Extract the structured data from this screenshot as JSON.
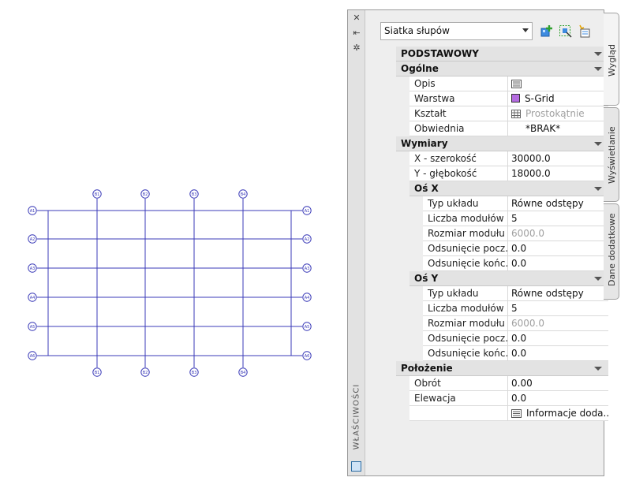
{
  "drawing": {
    "column_bubbles_top": [
      "B1",
      "B2",
      "B3",
      "B4"
    ],
    "column_bubbles_bottom": [
      "B1",
      "B2",
      "B3",
      "B4"
    ],
    "row_bubbles_left": [
      "A1",
      "A2",
      "A3",
      "A4",
      "A5",
      "A6"
    ],
    "row_bubbles_right": [
      "A1",
      "A2",
      "A3",
      "A4",
      "A5",
      "A6"
    ],
    "line_color": "#3b3bb8"
  },
  "palette": {
    "title": "WŁAŚCIWOŚCI",
    "style_select": "Siatka słupów",
    "tabs": [
      "Wygląd",
      "Wyświetlanie",
      "Dane dodatkowe"
    ],
    "icons": [
      "add-style-icon",
      "select-similar-icon",
      "quick-select-icon"
    ]
  },
  "properties": {
    "cat_basic": "PODSTAWOWY",
    "general": {
      "header": "Ogólne",
      "opis_label": "Opis",
      "warstwa_label": "Warstwa",
      "warstwa_value": "S-Grid",
      "ksztalt_label": "Kształt",
      "ksztalt_value": "Prostokątnie",
      "obwiednia_label": "Obwiednia",
      "obwiednia_value": "*BRAK*"
    },
    "dims": {
      "header": "Wymiary",
      "x_label": "X - szerokość",
      "x_value": "30000.0",
      "y_label": "Y - głębokość",
      "y_value": "18000.0"
    },
    "axis_x": {
      "header": "Oś X",
      "typ_label": "Typ układu",
      "typ_value": "Równe odstępy",
      "liczba_label": "Liczba modułów",
      "liczba_value": "5",
      "rozmiar_label": "Rozmiar modułu",
      "rozmiar_value": "6000.0",
      "odp_label": "Odsunięcie pocz...",
      "odp_value": "0.0",
      "odk_label": "Odsunięcie końc...",
      "odk_value": "0.0"
    },
    "axis_y": {
      "header": "Oś Y",
      "typ_label": "Typ układu",
      "typ_value": "Równe odstępy",
      "liczba_label": "Liczba modułów",
      "liczba_value": "5",
      "rozmiar_label": "Rozmiar modułu",
      "rozmiar_value": "6000.0",
      "odp_label": "Odsunięcie pocz...",
      "odp_value": "0.0",
      "odk_label": "Odsunięcie końc...",
      "odk_value": "0.0"
    },
    "location": {
      "header": "Położenie",
      "obrot_label": "Obrót",
      "obrot_value": "0.00",
      "elewacja_label": "Elewacja",
      "elewacja_value": "0.0",
      "info_value": "Informacje doda..."
    }
  }
}
